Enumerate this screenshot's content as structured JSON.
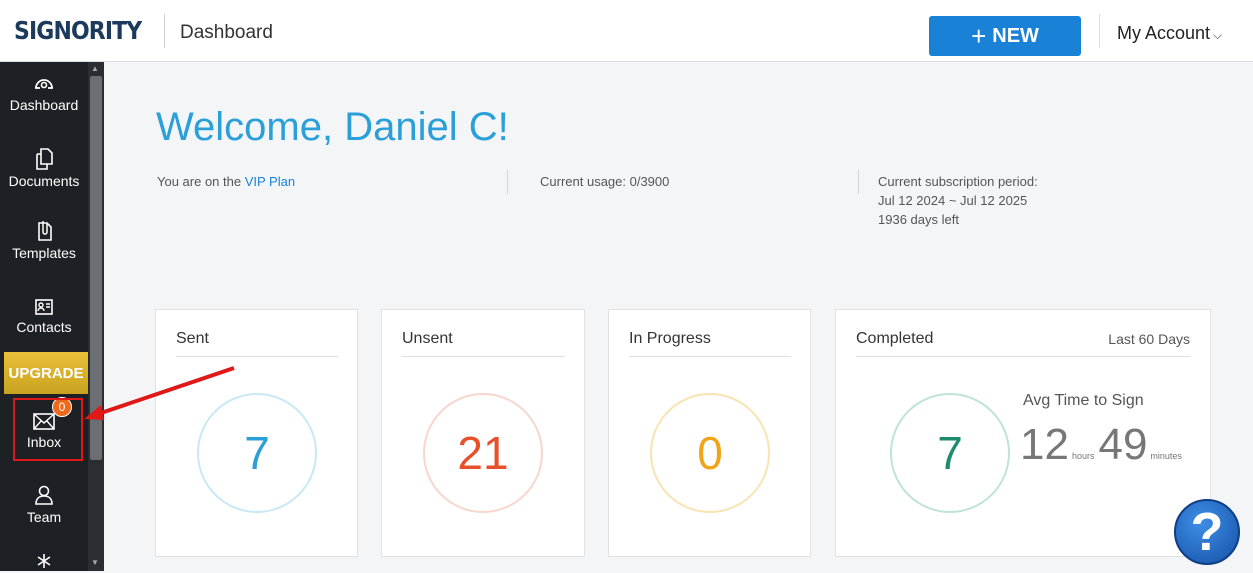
{
  "header": {
    "logo": "SIGNORITY",
    "page_title": "Dashboard",
    "new_label": "NEW",
    "new_plus": "+",
    "account_label": "My Account",
    "account_chevron": "⌵"
  },
  "sidebar": {
    "items": [
      {
        "label": "Dashboard",
        "icon": "gauge-icon"
      },
      {
        "label": "Documents",
        "icon": "documents-icon"
      },
      {
        "label": "Templates",
        "icon": "templates-icon"
      },
      {
        "label": "Contacts",
        "icon": "contact-card-icon"
      },
      {
        "label": "Inbox",
        "icon": "envelope-icon"
      },
      {
        "label": "Team",
        "icon": "person-icon"
      },
      {
        "label": "",
        "icon": "asterisk-icon"
      }
    ],
    "upgrade_label": "UPGRADE",
    "inbox_badge": "0",
    "scroll_up": "▲",
    "scroll_down": "▼"
  },
  "welcome": {
    "title": "Welcome, Daniel C!",
    "plan_prefix": "You are on the ",
    "plan_name": "VIP Plan",
    "usage": "Current usage: 0/3900",
    "subscription_label": "Current subscription period:",
    "subscription_range": "Jul 12 2024 ~ Jul 12 2025",
    "days_left": "1936 days left"
  },
  "cards": [
    {
      "title": "Sent",
      "value": "7",
      "color": "#2a9fd8",
      "ring": "#c8e8f6"
    },
    {
      "title": "Unsent",
      "value": "21",
      "color": "#e8502a",
      "ring": "#f8d6ce"
    },
    {
      "title": "In Progress",
      "value": "0",
      "color": "#f0a418",
      "ring": "#f9e3b3"
    },
    {
      "title": "Completed",
      "value": "7",
      "color": "#1e8a6e",
      "ring": "#bfe3d7",
      "period": "Last 60 Days"
    }
  ],
  "avg_time": {
    "label": "Avg Time to Sign",
    "hours": "12",
    "hours_unit": "hours",
    "minutes": "49",
    "minutes_unit": "minutes"
  },
  "help": {
    "symbol": "?"
  },
  "colors": {
    "accent": "#1a82d6",
    "sidebar_bg": "#1d2125",
    "upgrade": "#e9c13b",
    "annotation_red": "#e01818"
  }
}
